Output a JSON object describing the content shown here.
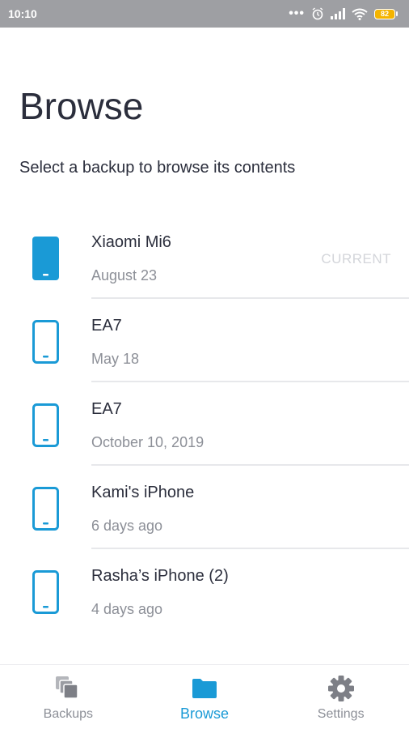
{
  "status_bar": {
    "time": "10:10",
    "battery": "82",
    "icons": [
      "more-dots-icon",
      "alarm-icon",
      "signal-icon",
      "wifi-icon",
      "battery-icon"
    ]
  },
  "header": {
    "title": "Browse",
    "subtitle": "Select a backup to browse its contents"
  },
  "backups": [
    {
      "name": "Xiaomi Mi6",
      "date": "August 23",
      "badge": "CURRENT",
      "icon": "phone-filled-icon"
    },
    {
      "name": "EA7",
      "date": "May 18",
      "badge": "",
      "icon": "phone-outline-icon"
    },
    {
      "name": "EA7",
      "date": "October 10, 2019",
      "badge": "",
      "icon": "phone-outline-icon"
    },
    {
      "name": "Kami's iPhone",
      "date": "6 days ago",
      "badge": "",
      "icon": "phone-outline-icon"
    },
    {
      "name": "Rasha’s iPhone (2)",
      "date": "4 days ago",
      "badge": "",
      "icon": "phone-outline-icon"
    }
  ],
  "bottom_nav": {
    "items": [
      {
        "label": "Backups",
        "icon": "stacked-squares-icon",
        "active": false
      },
      {
        "label": "Browse",
        "icon": "folder-icon",
        "active": true
      },
      {
        "label": "Settings",
        "icon": "gear-icon",
        "active": false
      }
    ]
  },
  "colors": {
    "accent": "#1a9ad6",
    "text_primary": "#2b2e3c",
    "text_secondary": "#8c8f97",
    "badge": "#d3d5da",
    "status_bar": "#9e9fa3",
    "nav_inactive_icon": "#7d7f86"
  }
}
